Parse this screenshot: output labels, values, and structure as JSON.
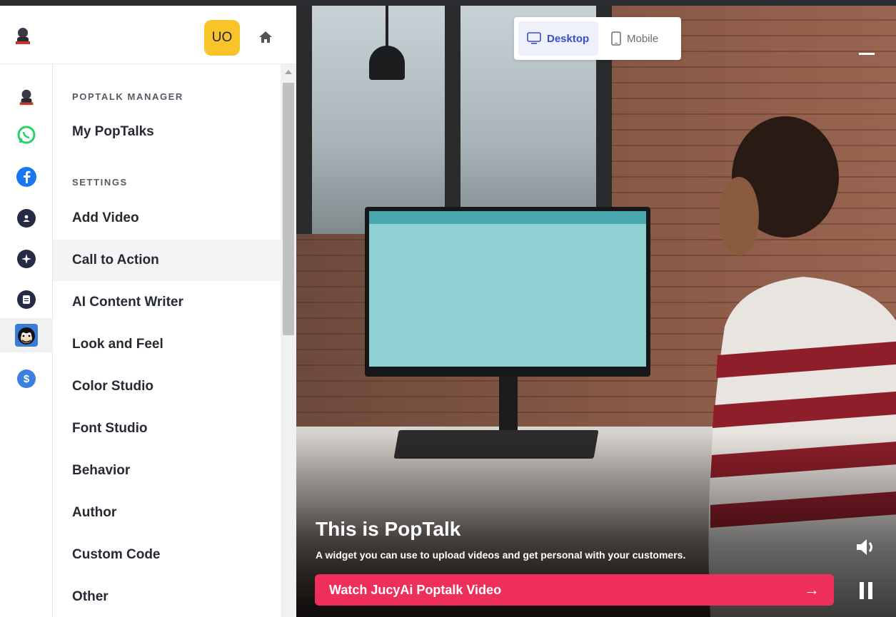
{
  "header": {
    "avatar_initials": "UO"
  },
  "rail": {
    "icons": [
      "jucyai-logo",
      "whatsapp-icon",
      "facebook-icon",
      "user-icon",
      "sparkle-icon",
      "document-icon",
      "cartoon-cat-icon",
      "dollar-icon"
    ]
  },
  "menu": {
    "sections": [
      {
        "title": "POPTALK MANAGER",
        "items": [
          "My PopTalks"
        ]
      },
      {
        "title": "SETTINGS",
        "items": [
          "Add Video",
          "Call to Action",
          "AI Content Writer",
          "Look and Feel",
          "Color Studio",
          "Font Studio",
          "Behavior",
          "Author",
          "Custom Code",
          "Other"
        ]
      }
    ],
    "active": "Call to Action"
  },
  "preview": {
    "toggle": {
      "desktop": "Desktop",
      "mobile": "Mobile",
      "selected": "Desktop"
    },
    "title": "This is PopTalk",
    "subtitle": "A widget you can use to upload videos and get personal with your customers.",
    "cta": {
      "label": "Watch JucyAi Poptalk Video",
      "arrow": "→"
    },
    "colors": {
      "cta": "#ef2f5b",
      "avatar": "#f8c42a",
      "toggle_active": "#3a4dcc"
    }
  }
}
